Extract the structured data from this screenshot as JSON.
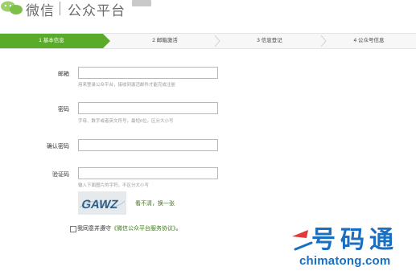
{
  "header": {
    "logo_text": "微信",
    "logo_subtitle": "公众平台"
  },
  "steps": [
    {
      "label": "1 基本信息",
      "active": true
    },
    {
      "label": "2 邮箱激活",
      "active": false
    },
    {
      "label": "3 信息登记",
      "active": false
    },
    {
      "label": "4 公众号信息",
      "active": false
    }
  ],
  "form": {
    "email": {
      "label": "邮箱",
      "value": "",
      "hint": "用来登录公众平台，接收到激活邮件才能完成注册"
    },
    "password": {
      "label": "密码",
      "value": "",
      "hint": "字母、数字或者英文符号，最短6位，区分大小写"
    },
    "confirm_password": {
      "label": "确认密码",
      "value": ""
    },
    "captcha": {
      "label": "验证码",
      "value": "",
      "hint": "输入下面图片的字符，不区分大小写",
      "image_text": "GAWZ",
      "refresh_label": "看不清，换一张"
    }
  },
  "agreement": {
    "checked": false,
    "prefix": "我同意并遵守",
    "link": "《微信公众平台服务协议》",
    "suffix": "。"
  },
  "watermark": {
    "brand_chars": "号码通",
    "url": "chimatong.com"
  },
  "colors": {
    "accent_green": "#5bab2b",
    "link_green": "#3b7a17",
    "watermark_blue": "#1a6fc1"
  }
}
